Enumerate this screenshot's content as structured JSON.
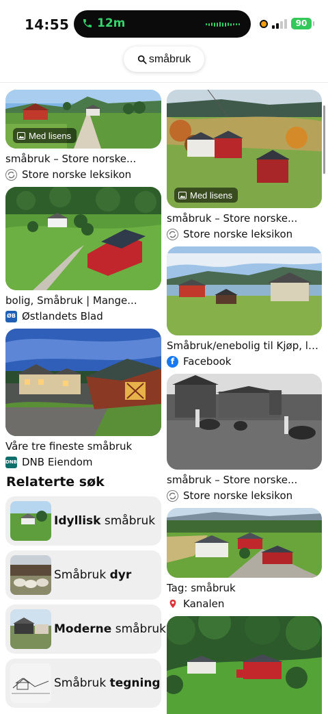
{
  "status_bar": {
    "time": "14:55",
    "call_duration": "12m",
    "battery": "90"
  },
  "search": {
    "query": "småbruk"
  },
  "left_pins": [
    {
      "title": "småbruk – Store norske...",
      "source": "Store norske leksikon",
      "badge": "Med lisens",
      "source_icon": "snl-icon"
    },
    {
      "title": "bolig, Småbruk | Mange...",
      "source": "Østlandets Blad",
      "source_icon": "ob-logo-icon"
    },
    {
      "title": "Våre tre fineste småbruk",
      "source": "DNB Eiendom",
      "source_icon": "dnb-logo-icon"
    }
  ],
  "right_pins": [
    {
      "title": "småbruk – Store norske...",
      "source": "Store norske leksikon",
      "badge": "Med lisens",
      "source_icon": "snl-icon"
    },
    {
      "title": "Småbruk/enebolig til Kjøp, leie...",
      "source": "Facebook",
      "source_icon": "facebook-icon"
    },
    {
      "title": "småbruk – Store norske...",
      "source": "Store norske leksikon",
      "source_icon": "snl-icon"
    },
    {
      "title": "Tag: småbruk",
      "source": "Kanalen",
      "source_icon": "kanalen-icon"
    },
    {
      "title": "",
      "source": ""
    }
  ],
  "related": {
    "heading": "Relaterte søk",
    "items": [
      {
        "pre": "",
        "bold": "Idyllisk",
        "post": " småbruk"
      },
      {
        "pre": "Småbruk ",
        "bold": "dyr",
        "post": ""
      },
      {
        "pre": "",
        "bold": "Moderne",
        "post": " småbruk"
      },
      {
        "pre": "Småbruk ",
        "bold": "tegning",
        "post": ""
      }
    ]
  },
  "colors": {
    "facebook": "#1877f2",
    "kanalen": "#e0323b",
    "dnb": "#0e6e6a",
    "ob": "#1f5fb4",
    "battery": "#34c759",
    "call": "#37d26b"
  }
}
